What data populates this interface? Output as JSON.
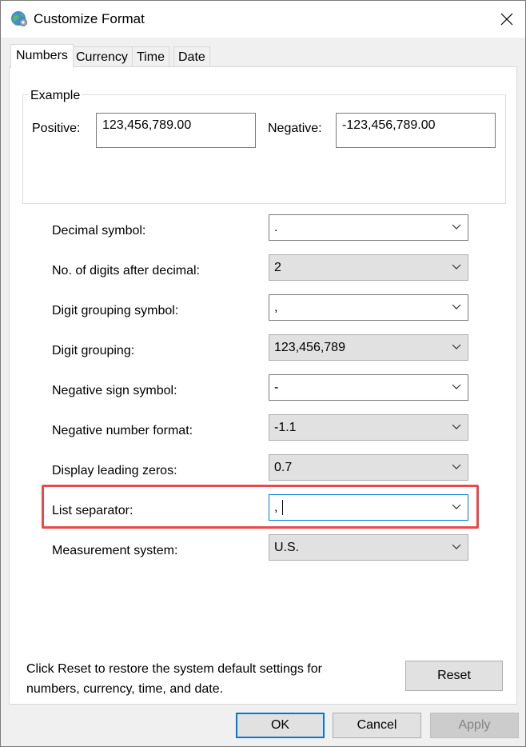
{
  "window": {
    "title": "Customize Format"
  },
  "tabs": [
    {
      "label": "Numbers",
      "active": true
    },
    {
      "label": "Currency",
      "active": false
    },
    {
      "label": "Time",
      "active": false
    },
    {
      "label": "Date",
      "active": false
    }
  ],
  "example": {
    "legend": "Example",
    "positive_label": "Positive:",
    "positive_value": "123,456,789.00",
    "negative_label": "Negative:",
    "negative_value": "-123,456,789.00"
  },
  "settings": [
    {
      "label": "Decimal symbol:",
      "value": "."
    },
    {
      "label": "No. of digits after decimal:",
      "value": "2"
    },
    {
      "label": "Digit grouping symbol:",
      "value": ","
    },
    {
      "label": "Digit grouping:",
      "value": "123,456,789"
    },
    {
      "label": "Negative sign symbol:",
      "value": "-"
    },
    {
      "label": "Negative number format:",
      "value": "-1.1"
    },
    {
      "label": "Display leading zeros:",
      "value": "0.7"
    },
    {
      "label": "List separator:",
      "value": ","
    },
    {
      "label": "Measurement system:",
      "value": "U.S."
    }
  ],
  "footer": {
    "info_text": "Click Reset to restore the system default settings for numbers, currency, time, and date.",
    "reset_label": "Reset"
  },
  "buttons": {
    "ok": "OK",
    "cancel": "Cancel",
    "apply": "Apply"
  },
  "colors": {
    "highlight": "#e8494a",
    "focus": "#0078d7"
  }
}
